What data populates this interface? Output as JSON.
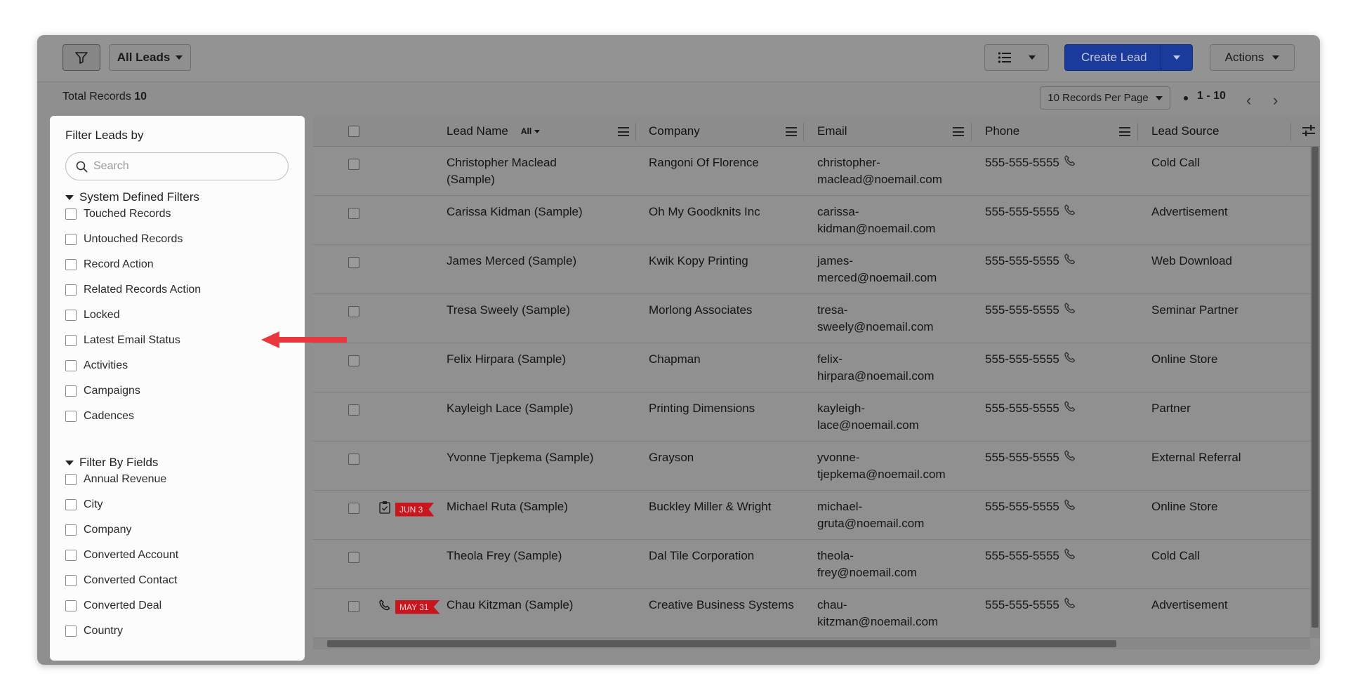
{
  "toolbar": {
    "view_label": "All Leads",
    "create_label": "Create Lead",
    "actions_label": "Actions"
  },
  "records": {
    "total_label": "Total Records",
    "total_count": "10",
    "per_page": "10 Records Per Page",
    "range": "1 - 10"
  },
  "filter_panel": {
    "title": "Filter Leads by",
    "search_placeholder": "Search",
    "system_section": "System Defined Filters",
    "system_filters": [
      "Touched Records",
      "Untouched Records",
      "Record Action",
      "Related Records Action",
      "Locked",
      "Latest Email Status",
      "Activities",
      "Campaigns",
      "Cadences"
    ],
    "fields_section": "Filter By Fields",
    "field_filters": [
      "Annual Revenue",
      "City",
      "Company",
      "Converted Account",
      "Converted Contact",
      "Converted Deal",
      "Country"
    ]
  },
  "table": {
    "columns": {
      "lead_name": "Lead Name",
      "lead_name_filter": "All",
      "company": "Company",
      "email": "Email",
      "phone": "Phone",
      "lead_source": "Lead Source"
    },
    "rows": [
      {
        "name_1": "Christopher Maclead",
        "name_2": "(Sample)",
        "company": "Rangoni Of Florence",
        "email_1": "christopher-",
        "email_2": "maclead@noemail.com",
        "phone": "555-555-5555",
        "source": "Cold Call",
        "tag": ""
      },
      {
        "name_1": "Carissa Kidman (Sample)",
        "name_2": "",
        "company": "Oh My Goodknits Inc",
        "email_1": "carissa-",
        "email_2": "kidman@noemail.com",
        "phone": "555-555-5555",
        "source": "Advertisement",
        "tag": ""
      },
      {
        "name_1": "James Merced (Sample)",
        "name_2": "",
        "company": "Kwik Kopy Printing",
        "email_1": "james-",
        "email_2": "merced@noemail.com",
        "phone": "555-555-5555",
        "source": "Web Download",
        "tag": ""
      },
      {
        "name_1": "Tresa Sweely (Sample)",
        "name_2": "",
        "company": "Morlong Associates",
        "email_1": "tresa-",
        "email_2": "sweely@noemail.com",
        "phone": "555-555-5555",
        "source": "Seminar Partner",
        "tag": ""
      },
      {
        "name_1": "Felix Hirpara (Sample)",
        "name_2": "",
        "company": "Chapman",
        "email_1": "felix-",
        "email_2": "hirpara@noemail.com",
        "phone": "555-555-5555",
        "source": "Online Store",
        "tag": ""
      },
      {
        "name_1": "Kayleigh Lace (Sample)",
        "name_2": "",
        "company": "Printing Dimensions",
        "email_1": "kayleigh-",
        "email_2": "lace@noemail.com",
        "phone": "555-555-5555",
        "source": "Partner",
        "tag": ""
      },
      {
        "name_1": "Yvonne Tjepkema (Sample)",
        "name_2": "",
        "company": "Grayson",
        "email_1": "yvonne-",
        "email_2": "tjepkema@noemail.com",
        "phone": "555-555-5555",
        "source": "External Referral",
        "tag": ""
      },
      {
        "name_1": "Michael Ruta (Sample)",
        "name_2": "",
        "company": "Buckley Miller & Wright",
        "email_1": "michael-",
        "email_2": "gruta@noemail.com",
        "phone": "555-555-5555",
        "source": "Online Store",
        "tag": "JUN 3",
        "tag_icon": "task-check-icon"
      },
      {
        "name_1": "Theola Frey (Sample)",
        "name_2": "",
        "company": "Dal Tile Corporation",
        "email_1": "theola-",
        "email_2": "frey@noemail.com",
        "phone": "555-555-5555",
        "source": "Cold Call",
        "tag": ""
      },
      {
        "name_1": "Chau Kitzman (Sample)",
        "name_2": "",
        "company": "Creative Business Systems",
        "email_1": "chau-",
        "email_2": "kitzman@noemail.com",
        "phone": "555-555-5555",
        "source": "Advertisement",
        "tag": "MAY 31",
        "tag_icon": "call-icon"
      }
    ]
  },
  "colors": {
    "overlay": "#8f8f8f",
    "create_button": "#1b3b9c",
    "date_ribbon": "#c8161e",
    "annotation_arrow": "#e8383d"
  }
}
